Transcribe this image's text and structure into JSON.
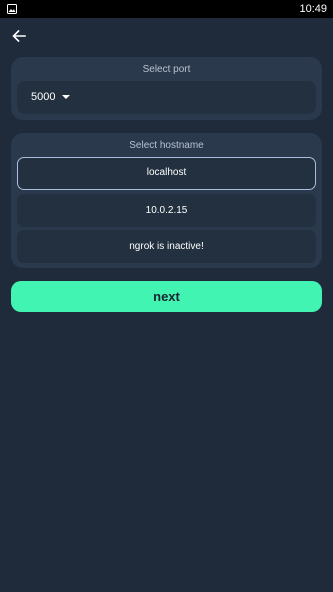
{
  "status_bar": {
    "time": "10:49",
    "image_icon": "image-icon"
  },
  "toolbar": {
    "back_icon": "arrow-left-icon"
  },
  "port": {
    "title": "Select port",
    "value": "5000",
    "caret_icon": "chevron-down-icon"
  },
  "hostname": {
    "title": "Select hostname",
    "options": [
      {
        "label": "localhost",
        "selected": true
      },
      {
        "label": "10.0.2.15",
        "selected": false
      },
      {
        "label": "ngrok is inactive!",
        "selected": false
      }
    ]
  },
  "actions": {
    "next_label": "next"
  },
  "colors": {
    "background": "#1f2b3b",
    "card": "#2a394b",
    "accent": "#41f4b2",
    "selected_border": "#a9bedc"
  }
}
